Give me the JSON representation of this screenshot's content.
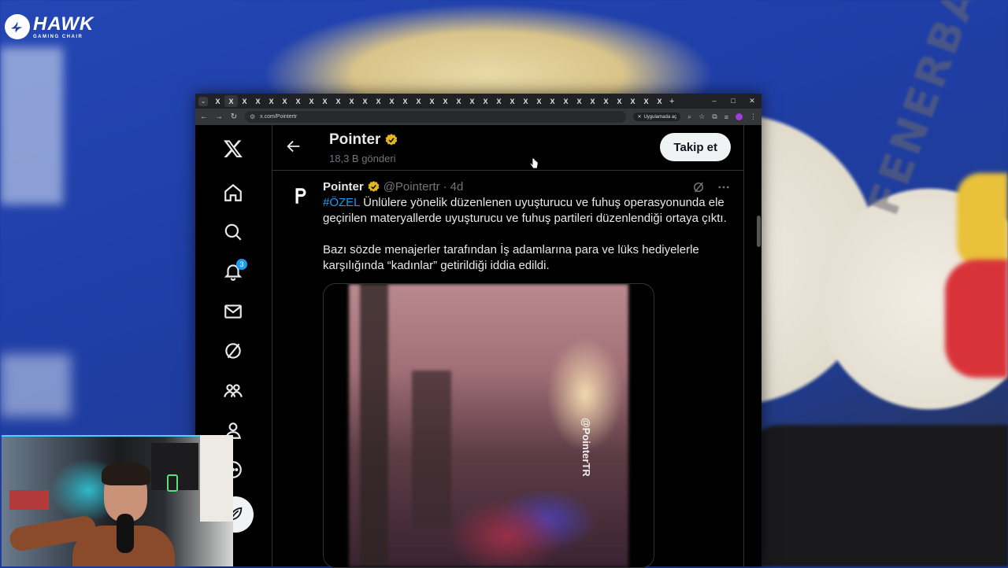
{
  "overlay": {
    "brand_name": "HAWK",
    "brand_tagline": "GAMING CHAIR"
  },
  "background": {
    "club_text": "FENERBAHÇE"
  },
  "browser": {
    "tab_glyph": "X",
    "new_tab": "+",
    "url": "x.com/Pointertr",
    "open_in_app": "Uygulamada aç",
    "window_minimize": "–",
    "window_maximize": "□",
    "window_close": "✕"
  },
  "x": {
    "notifications_count": "3",
    "header": {
      "name": "Pointer",
      "post_count": "18,3 B gönderi",
      "follow_label": "Takip et"
    },
    "tweet": {
      "author_name": "Pointer",
      "author_handle": "@Pointertr",
      "separator": "·",
      "time": "4d",
      "hashtag": "#ÖZEL",
      "text_part1": " Ünlülere yönelik düzenlenen uyuşturucu ve fuhuş operasyonunda ele geçirilen materyallerde uyuşturucu ve fuhuş partileri düzenlendiği ortaya çıktı.",
      "text_part2": "Bazı sözde menajerler tarafından İş adamlarına para ve lüks hediyelerle karşılığında “kadınlar” getirildiği iddia edildi.",
      "media_watermark": "@PointerTR"
    }
  },
  "colors": {
    "x_blue": "#1d9bf0",
    "verified_gold": "#e2b719",
    "background_blue": "#1f3ea6"
  }
}
